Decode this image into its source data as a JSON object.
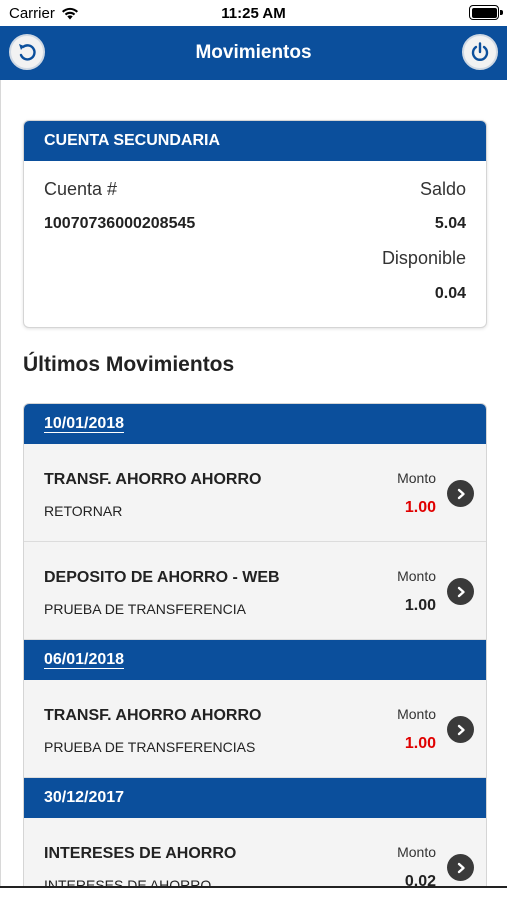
{
  "status_bar": {
    "carrier": "Carrier",
    "time": "11:25 AM",
    "battery_level": 1.0
  },
  "nav": {
    "title": "Movimientos",
    "back_icon": "back-arrow-icon",
    "power_icon": "power-icon",
    "color": "#0b4f9c"
  },
  "account": {
    "header": "CUENTA SECUNDARIA",
    "account_label": "Cuenta #",
    "account_number": "10070736000208545",
    "saldo_label": "Saldo",
    "saldo_value": "5.04",
    "disponible_label": "Disponible",
    "disponible_value": "0.04"
  },
  "section_title": "Últimos Movimientos",
  "movements": [
    {
      "date": "10/01/2018",
      "items": [
        {
          "title": "TRANSF. AHORRO AHORRO",
          "description": "RETORNAR",
          "monto_label": "Monto",
          "amount": "1.00",
          "amount_color": "#e00000"
        },
        {
          "title": "DEPOSITO DE AHORRO - WEB",
          "description": "PRUEBA DE TRANSFERENCIA",
          "monto_label": "Monto",
          "amount": "1.00",
          "amount_color": "#222222"
        }
      ]
    },
    {
      "date": "06/01/2018",
      "items": [
        {
          "title": "TRANSF. AHORRO AHORRO",
          "description": "PRUEBA DE TRANSFERENCIAS",
          "monto_label": "Monto",
          "amount": "1.00",
          "amount_color": "#e00000"
        }
      ]
    },
    {
      "date": "30/12/2017",
      "items": [
        {
          "title": "INTERESES DE AHORRO",
          "description": "INTERESES DE AHORRO",
          "monto_label": "Monto",
          "amount": "0.02",
          "amount_color": "#222222"
        }
      ]
    }
  ]
}
